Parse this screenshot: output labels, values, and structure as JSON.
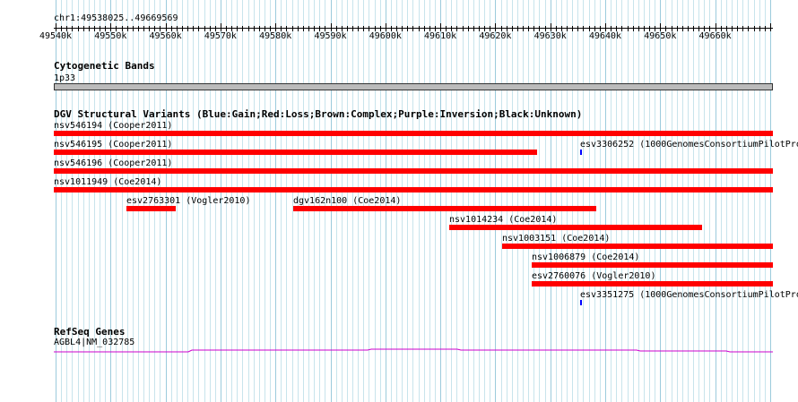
{
  "ruler": {
    "location": "chr1:49538025..49669569",
    "ticks": [
      "49540k",
      "49550k",
      "49560k",
      "49570k",
      "49580k",
      "49590k",
      "49600k",
      "49610k",
      "49620k",
      "49630k",
      "49640k",
      "49650k",
      "49660k"
    ]
  },
  "tracks": {
    "cytoband": {
      "title": "Cytogenetic Bands",
      "label": "1p33"
    },
    "dgv": {
      "title": "DGV Structural Variants (Blue:Gain;Red:Loss;Brown:Complex;Purple:Inversion;Black:Unknown)",
      "features": [
        {
          "label": "nsv546194 (Cooper2011)",
          "color": "red"
        },
        {
          "label": "nsv546195 (Cooper2011)",
          "color": "red"
        },
        {
          "label": "esv3306252 (1000GenomesConsortiumPilotPro",
          "color": "blue"
        },
        {
          "label": "nsv546196 (Cooper2011)",
          "color": "red"
        },
        {
          "label": "nsv1011949 (Coe2014)",
          "color": "red"
        },
        {
          "label": "esv2763301 (Vogler2010)",
          "color": "red"
        },
        {
          "label": "dgv162n100 (Coe2014)",
          "color": "red"
        },
        {
          "label": "nsv1014234 (Coe2014)",
          "color": "red"
        },
        {
          "label": "nsv1003151 (Coe2014)",
          "color": "red"
        },
        {
          "label": "nsv1006879 (Coe2014)",
          "color": "red"
        },
        {
          "label": "esv2760076 (Vogler2010)",
          "color": "red"
        },
        {
          "label": "esv3351275 (1000GenomesConsortiumPilotPro",
          "color": "blue"
        }
      ]
    },
    "refseq": {
      "title": "RefSeq Genes",
      "gene_label": "AGBL4|NM_032785"
    }
  },
  "colors": {
    "loss": "#ff0000",
    "gain": "#0000ff",
    "gene": "#cc00cc",
    "grid_minor": "#c8e4ec",
    "grid_major": "#9ccbdc"
  }
}
